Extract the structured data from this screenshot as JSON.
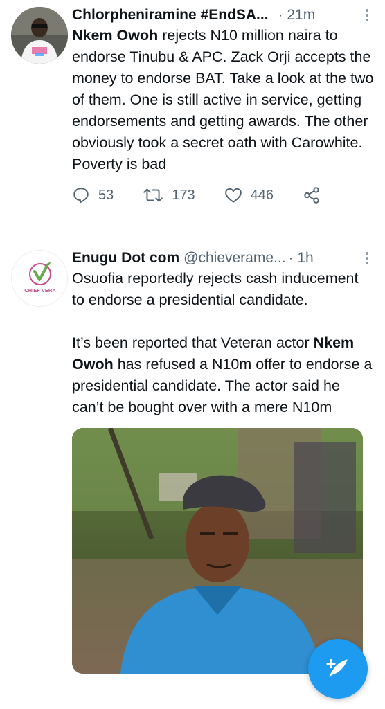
{
  "tweets": [
    {
      "author_name": "Chlorpheniramine #EndSA...",
      "handle": "",
      "time": "· 21m",
      "text_parts": [
        {
          "bold": "Nkem Owoh"
        },
        {
          "text": " rejects N10 million naira to endorse Tinubu & APC. Zack Orji accepts the money to endorse BAT. Take a look at the two of them. One is still active in service, getting endorsements and getting awards. The other obviously took a secret oath with Carowhite. Poverty is bad"
        }
      ],
      "actions": {
        "replies": "53",
        "retweets": "173",
        "likes": "446"
      }
    },
    {
      "author_name": "Enugu Dot com",
      "handle": "@chieverame...",
      "time": "· 1h",
      "avatar_brand": "CHIEF VERA",
      "para1": "Osuofia reportedly rejects cash inducement to endorse a presidential candidate.",
      "para2_prefix": "It’s been reported that Veteran actor ",
      "para2_bold": "Nkem Owoh",
      "para2_suffix": " has refused a N10m offer to endorse a presidential candidate. The actor said he can’t be bought over with a mere N10m"
    }
  ],
  "colors": {
    "accent": "#1d9bf0",
    "muted_text": "#536471",
    "divider": "#e6ecf0"
  },
  "icons": {
    "reply": "reply-icon",
    "retweet": "retweet-icon",
    "like": "heart-icon",
    "share": "share-icon",
    "more": "more-icon",
    "compose": "compose-tweet-icon"
  }
}
